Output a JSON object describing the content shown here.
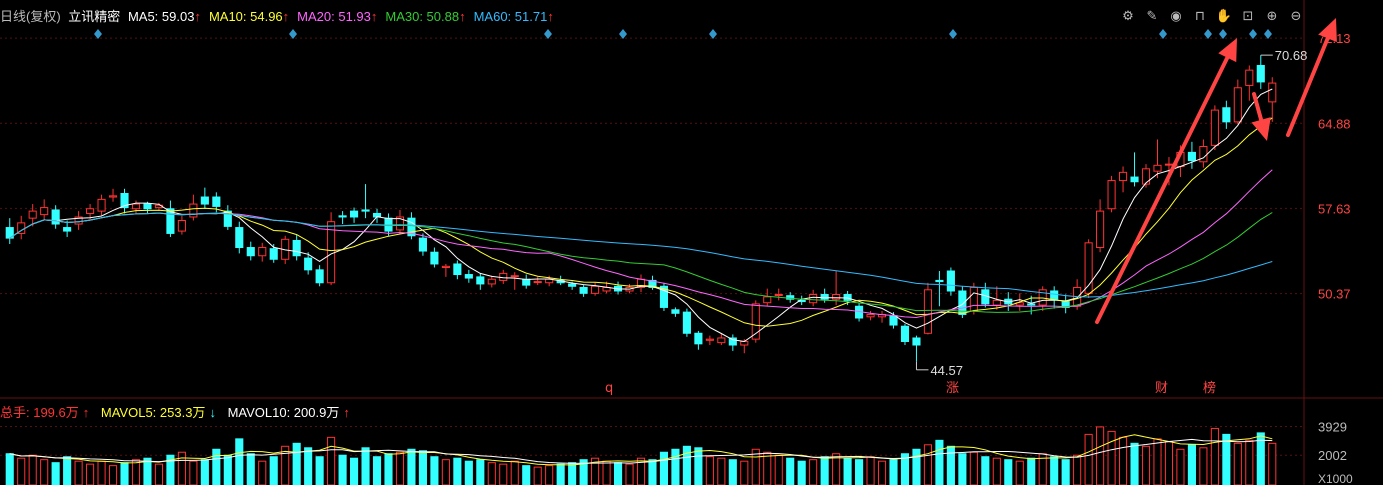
{
  "header": {
    "period": "日线(复权)",
    "stock_name": "立讯精密",
    "ma": [
      {
        "label": "MA5: 59.03",
        "arrow": "↑",
        "color": "#ffffff"
      },
      {
        "label": "MA10: 54.96",
        "arrow": "↑",
        "color": "#ffff33"
      },
      {
        "label": "MA20: 51.93",
        "arrow": "↑",
        "color": "#ff66ff"
      },
      {
        "label": "MA30: 50.88",
        "arrow": "↑",
        "color": "#33cc33"
      },
      {
        "label": "MA60: 51.71",
        "arrow": "↑",
        "color": "#33bbff"
      }
    ]
  },
  "toolbar": {
    "icons": [
      "gear-icon",
      "pen-icon",
      "eye-icon",
      "basket-icon",
      "hand-icon",
      "lock-icon",
      "zoom-in-icon",
      "zoom-out-icon"
    ]
  },
  "volume_header": {
    "total": "总手: 199.6万",
    "total_arrow": "↑",
    "mavol5": "MAVOL5: 253.3万",
    "mavol5_arrow": "↓",
    "mavol10": "MAVOL10: 200.9万",
    "mavol10_arrow": "↑"
  },
  "annotations": {
    "high_label": "70.68",
    "low_label": "44.57",
    "markers": [
      "q",
      "涨",
      "财",
      "榜"
    ]
  },
  "colors": {
    "up": "#ff3333",
    "down": "#33ffff",
    "ma5": "#ffffff",
    "ma10": "#ffff33",
    "ma20": "#ff66ff",
    "ma30": "#33cc33",
    "ma60": "#33bbff",
    "diamond": "#3399cc",
    "arrow": "#ff4444"
  },
  "chart_data": {
    "type": "candlestick",
    "y_axis": {
      "ticks": [
        "72.13",
        "64.88",
        "57.63",
        "50.37"
      ],
      "ylim": [
        42.0,
        73.5
      ]
    },
    "volume_axis": {
      "ticks": [
        "3929",
        "2002"
      ],
      "unit": "X1000",
      "ylim": [
        0,
        4500
      ]
    },
    "candles": [
      [
        56.0,
        55.1,
        56.8,
        54.6,
        2.1
      ],
      [
        55.5,
        56.4,
        57.0,
        55.0,
        1.8
      ],
      [
        56.8,
        57.4,
        58.0,
        56.1,
        2.0
      ],
      [
        57.1,
        57.7,
        58.4,
        56.7,
        1.7
      ],
      [
        57.5,
        56.3,
        57.9,
        55.9,
        1.5
      ],
      [
        56.0,
        55.7,
        56.6,
        55.2,
        1.9
      ],
      [
        56.3,
        56.9,
        57.4,
        55.8,
        1.6
      ],
      [
        57.2,
        57.6,
        58.0,
        56.7,
        1.4
      ],
      [
        57.4,
        58.4,
        58.8,
        57.0,
        1.6
      ],
      [
        58.6,
        58.7,
        59.3,
        58.2,
        1.3
      ],
      [
        58.9,
        57.7,
        59.3,
        57.2,
        1.5
      ],
      [
        57.6,
        58.0,
        58.3,
        57.2,
        1.7
      ],
      [
        58.0,
        57.6,
        58.2,
        57.2,
        1.8
      ],
      [
        57.7,
        57.9,
        58.1,
        57.5,
        1.4
      ],
      [
        57.6,
        55.5,
        58.3,
        55.2,
        2.0
      ],
      [
        55.7,
        56.6,
        57.0,
        55.4,
        2.2
      ],
      [
        56.9,
        58.0,
        58.8,
        56.6,
        1.6
      ],
      [
        58.6,
        58.0,
        59.4,
        57.6,
        1.7
      ],
      [
        58.6,
        57.8,
        59.0,
        57.3,
        2.4
      ],
      [
        57.4,
        56.1,
        57.9,
        55.8,
        2.0
      ],
      [
        56.0,
        54.3,
        56.5,
        53.8,
        3.1
      ],
      [
        54.3,
        53.6,
        54.8,
        53.2,
        2.1
      ],
      [
        53.6,
        54.3,
        54.7,
        53.1,
        1.6
      ],
      [
        54.2,
        53.3,
        54.6,
        53.0,
        1.9
      ],
      [
        53.3,
        55.0,
        55.3,
        52.9,
        2.6
      ],
      [
        54.9,
        53.6,
        55.4,
        53.2,
        2.8
      ],
      [
        53.4,
        52.4,
        53.9,
        52.0,
        2.5
      ],
      [
        52.4,
        51.3,
        52.8,
        51.0,
        1.9
      ],
      [
        51.3,
        56.5,
        57.3,
        51.1,
        3.2
      ],
      [
        57.0,
        56.9,
        57.4,
        56.3,
        2.0
      ],
      [
        57.4,
        56.9,
        57.7,
        56.4,
        1.8
      ],
      [
        57.5,
        57.4,
        59.7,
        56.8,
        2.5
      ],
      [
        57.2,
        56.9,
        57.6,
        56.4,
        1.9
      ],
      [
        56.8,
        55.7,
        57.2,
        55.3,
        2.1
      ],
      [
        55.8,
        56.9,
        57.5,
        55.4,
        2.2
      ],
      [
        56.8,
        55.3,
        57.3,
        55.0,
        2.4
      ],
      [
        55.1,
        54.0,
        55.5,
        53.6,
        2.3
      ],
      [
        53.9,
        52.9,
        54.3,
        52.6,
        1.9
      ],
      [
        52.6,
        52.7,
        52.9,
        51.8,
        1.7
      ],
      [
        52.9,
        52.0,
        53.2,
        51.6,
        1.8
      ],
      [
        52.0,
        51.7,
        52.4,
        51.3,
        1.6
      ],
      [
        51.8,
        51.2,
        52.1,
        50.7,
        1.7
      ],
      [
        51.2,
        51.6,
        51.9,
        50.9,
        1.5
      ],
      [
        51.5,
        52.1,
        52.4,
        51.2,
        1.4
      ],
      [
        51.9,
        51.9,
        52.2,
        50.7,
        1.6
      ],
      [
        51.6,
        51.1,
        52.0,
        50.8,
        1.3
      ],
      [
        51.4,
        51.4,
        51.8,
        51.1,
        1.2
      ],
      [
        51.3,
        51.6,
        51.9,
        51.0,
        1.3
      ],
      [
        51.5,
        51.3,
        51.9,
        51.1,
        1.4
      ],
      [
        51.2,
        51.0,
        51.4,
        50.7,
        1.5
      ],
      [
        50.9,
        50.4,
        51.1,
        50.1,
        1.7
      ],
      [
        50.4,
        51.0,
        51.3,
        50.2,
        1.8
      ],
      [
        50.6,
        50.9,
        51.4,
        50.4,
        1.6
      ],
      [
        51.0,
        50.6,
        51.4,
        50.3,
        1.5
      ],
      [
        50.6,
        50.9,
        51.2,
        50.4,
        1.4
      ],
      [
        50.9,
        51.6,
        52.0,
        50.5,
        1.8
      ],
      [
        51.5,
        50.9,
        51.9,
        50.7,
        1.7
      ],
      [
        51.0,
        49.2,
        51.3,
        48.9,
        2.2
      ],
      [
        49.0,
        48.7,
        49.2,
        48.4,
        2.4
      ],
      [
        48.8,
        47.0,
        49.1,
        46.7,
        2.6
      ],
      [
        47.0,
        46.1,
        47.2,
        45.6,
        2.5
      ],
      [
        46.4,
        46.5,
        46.8,
        46.0,
        1.9
      ],
      [
        46.2,
        46.6,
        47.0,
        46.0,
        1.8
      ],
      [
        46.6,
        46.0,
        46.9,
        45.5,
        1.7
      ],
      [
        46.0,
        46.3,
        46.5,
        45.3,
        1.6
      ],
      [
        46.5,
        49.5,
        49.8,
        46.2,
        2.4
      ],
      [
        49.6,
        50.1,
        50.8,
        49.3,
        2.2
      ],
      [
        50.3,
        50.3,
        50.8,
        49.8,
        2.0
      ],
      [
        50.2,
        49.9,
        50.5,
        49.6,
        1.8
      ],
      [
        49.8,
        49.7,
        50.2,
        49.4,
        1.6
      ],
      [
        49.6,
        50.3,
        50.7,
        49.3,
        1.7
      ],
      [
        50.3,
        49.9,
        50.8,
        49.6,
        1.9
      ],
      [
        49.9,
        50.3,
        52.3,
        49.4,
        2.1
      ],
      [
        50.3,
        49.8,
        50.6,
        49.4,
        1.8
      ],
      [
        49.3,
        48.3,
        49.6,
        48.0,
        1.7
      ],
      [
        48.4,
        48.6,
        48.9,
        48.1,
        1.9
      ],
      [
        48.4,
        48.6,
        48.9,
        47.9,
        1.6
      ],
      [
        48.5,
        47.7,
        48.8,
        47.4,
        1.7
      ],
      [
        47.6,
        46.3,
        47.8,
        46.0,
        2.1
      ],
      [
        46.6,
        46.0,
        46.8,
        44.57,
        2.4
      ],
      [
        47.0,
        50.7,
        51.3,
        46.9,
        2.7
      ],
      [
        51.5,
        51.4,
        52.3,
        49.3,
        3.0
      ],
      [
        52.3,
        50.6,
        52.6,
        50.2,
        2.6
      ],
      [
        50.6,
        48.6,
        51.0,
        48.3,
        2.1
      ],
      [
        48.9,
        50.9,
        51.3,
        48.6,
        2.2
      ],
      [
        50.7,
        49.5,
        51.3,
        49.2,
        1.9
      ],
      [
        49.4,
        49.8,
        51.0,
        49.0,
        1.8
      ],
      [
        49.9,
        49.5,
        50.5,
        48.9,
        1.7
      ],
      [
        49.4,
        49.6,
        50.4,
        48.9,
        1.6
      ],
      [
        49.5,
        49.4,
        50.2,
        48.6,
        1.8
      ],
      [
        49.4,
        50.7,
        51.0,
        48.9,
        2.1
      ],
      [
        50.6,
        49.9,
        51.0,
        49.1,
        1.9
      ],
      [
        49.7,
        49.2,
        50.3,
        48.7,
        1.7
      ],
      [
        49.3,
        50.9,
        51.6,
        49.0,
        2.0
      ],
      [
        50.4,
        54.7,
        55.0,
        50.0,
        3.4
      ],
      [
        54.3,
        57.4,
        58.4,
        53.9,
        3.9
      ],
      [
        57.6,
        60.0,
        60.4,
        57.3,
        3.6
      ],
      [
        60.0,
        60.7,
        61.2,
        59.0,
        3.2
      ],
      [
        60.3,
        59.9,
        62.4,
        59.5,
        2.8
      ],
      [
        59.7,
        61.0,
        61.4,
        59.4,
        2.6
      ],
      [
        60.8,
        61.3,
        63.5,
        60.2,
        3.1
      ],
      [
        61.4,
        61.4,
        62.0,
        59.6,
        2.9
      ],
      [
        61.2,
        62.4,
        63.0,
        60.3,
        2.4
      ],
      [
        62.4,
        61.7,
        63.3,
        61.0,
        2.7
      ],
      [
        61.6,
        62.9,
        63.5,
        61.1,
        2.5
      ],
      [
        63.0,
        66.0,
        66.4,
        62.6,
        3.8
      ],
      [
        66.2,
        65.0,
        66.8,
        64.4,
        3.4
      ],
      [
        65.0,
        67.9,
        68.6,
        64.8,
        2.8
      ],
      [
        68.1,
        69.4,
        69.8,
        66.8,
        3.0
      ],
      [
        69.8,
        68.4,
        70.68,
        67.8,
        3.5
      ],
      [
        66.7,
        68.3,
        68.8,
        65.0,
        2.8
      ]
    ]
  }
}
